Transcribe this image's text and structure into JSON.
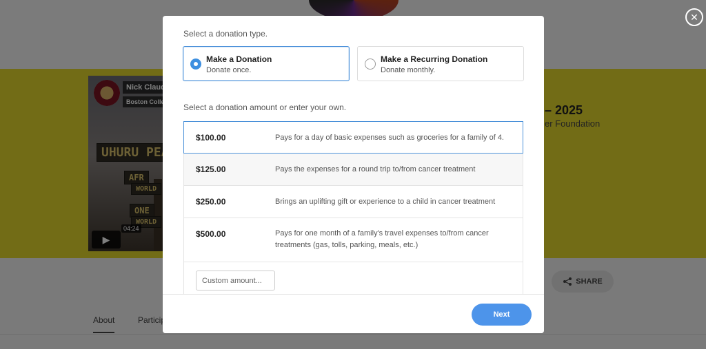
{
  "background": {
    "video": {
      "channel_name": "Nick Claudi",
      "channel_subtitle": "Boston Colle",
      "sign_text_1": "UHURU PEA",
      "sign_text_2": "AFR",
      "sign_text_3": "WORLD",
      "sign_text_4": "ONE",
      "sign_text_5": "WORLD",
      "play_icon": "▶",
      "duration": "04:24"
    },
    "campaign_title_fragment": "– 2025",
    "organization_fragment": "er Foundation",
    "share_label": "SHARE",
    "tabs": [
      "About",
      "Particip"
    ]
  },
  "close_icon": "✕",
  "modal": {
    "type_prompt": "Select a donation type.",
    "types": [
      {
        "title": "Make a Donation",
        "subtitle": "Donate once.",
        "selected": true
      },
      {
        "title": "Make a Recurring Donation",
        "subtitle": "Donate monthly.",
        "selected": false
      }
    ],
    "amount_prompt": "Select a donation amount or enter your own.",
    "amounts": [
      {
        "value": "$100.00",
        "description": "Pays for a day of basic expenses such as groceries for a family of 4."
      },
      {
        "value": "$125.00",
        "description": "Pays the expenses for a round trip to/from cancer treatment"
      },
      {
        "value": "$250.00",
        "description": "Brings an uplifting gift or experience to a child in cancer treatment"
      },
      {
        "value": "$500.00",
        "description": "Pays for one month of a family's travel expenses to/from cancer treatments (gas, tolls, parking, meals, etc.)"
      }
    ],
    "selected_amount_index": 0,
    "custom_placeholder": "Custom amount...",
    "next_label": "Next"
  },
  "colors": {
    "accent": "#4d94ea",
    "band": "#e5d92c"
  }
}
